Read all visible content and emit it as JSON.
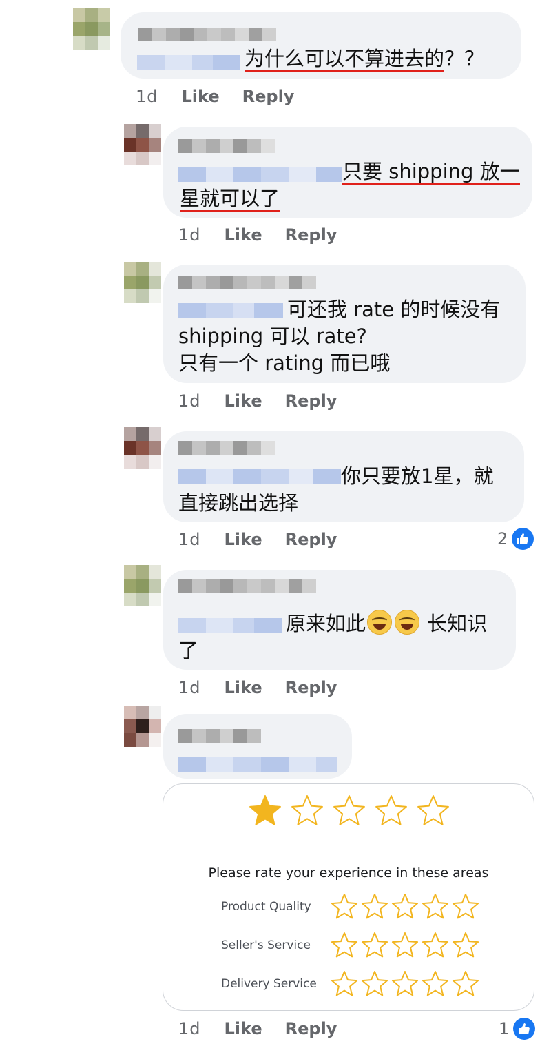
{
  "comments": [
    {
      "text_parts": [
        "为什么可以不算进去的",
        "？？"
      ],
      "time": "1d",
      "like": "Like",
      "reply": "Reply"
    },
    {
      "text_lines": [
        "只要 shipping 放一",
        "星就可以了"
      ],
      "time": "1d",
      "like": "Like",
      "reply": "Reply"
    },
    {
      "text_lines": [
        "可还我 rate 的时候没有",
        "shipping 可以 rate?",
        "只有一个 rating 而已哦"
      ],
      "time": "1d",
      "like": "Like",
      "reply": "Reply"
    },
    {
      "text_lines": [
        "你只要放1星，就",
        "直接跳出选择"
      ],
      "time": "1d",
      "like": "Like",
      "reply": "Reply",
      "reactions": "2"
    },
    {
      "text_lines": [
        "原来如此",
        "长知识",
        "了"
      ],
      "time": "1d",
      "like": "Like",
      "reply": "Reply"
    },
    {
      "time": "1d",
      "like": "Like",
      "reply": "Reply",
      "reactions": "1"
    }
  ],
  "rating_card": {
    "top_rating": 1,
    "top_max": 5,
    "title": "Please rate your experience in these areas",
    "rows": [
      {
        "label": "Product Quality",
        "rating": 0,
        "max": 5
      },
      {
        "label": "Seller's Service",
        "rating": 0,
        "max": 5
      },
      {
        "label": "Delivery Service",
        "rating": 0,
        "max": 5
      }
    ]
  },
  "colors": {
    "underline": "#e0211b",
    "like_blue": "#1877f2",
    "star_gold": "#f2b51f",
    "bubble": "#f0f2f5"
  }
}
